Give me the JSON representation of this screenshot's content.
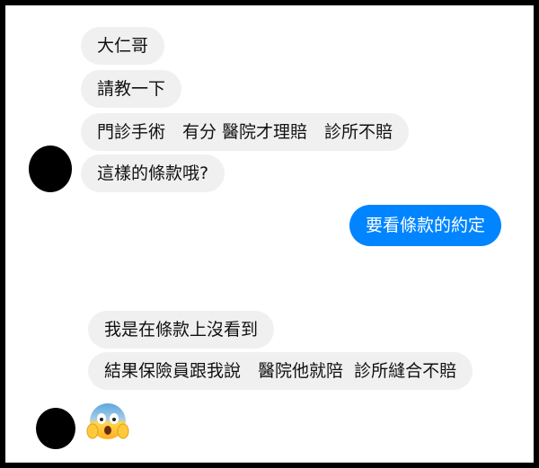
{
  "colors": {
    "frame": "#000000",
    "incoming_bubble": "#f1f0f0",
    "outgoing_bubble": "#0084ff",
    "incoming_text": "#111111",
    "outgoing_text": "#ffffff",
    "avatar": "#000000"
  },
  "conversation": {
    "group1": {
      "messages": [
        "大仁哥",
        "請教一下",
        "門診手術　有分 醫院才理賠　診所不賠",
        "這樣的條款哦?"
      ]
    },
    "outgoing": {
      "messages": [
        "要看條款的約定"
      ]
    },
    "group2": {
      "messages": [
        "我是在條款上沒看到",
        "結果保險員跟我說　醫院他就陪  診所縫合不賠"
      ],
      "emoji": "scared-face-emoji"
    }
  }
}
